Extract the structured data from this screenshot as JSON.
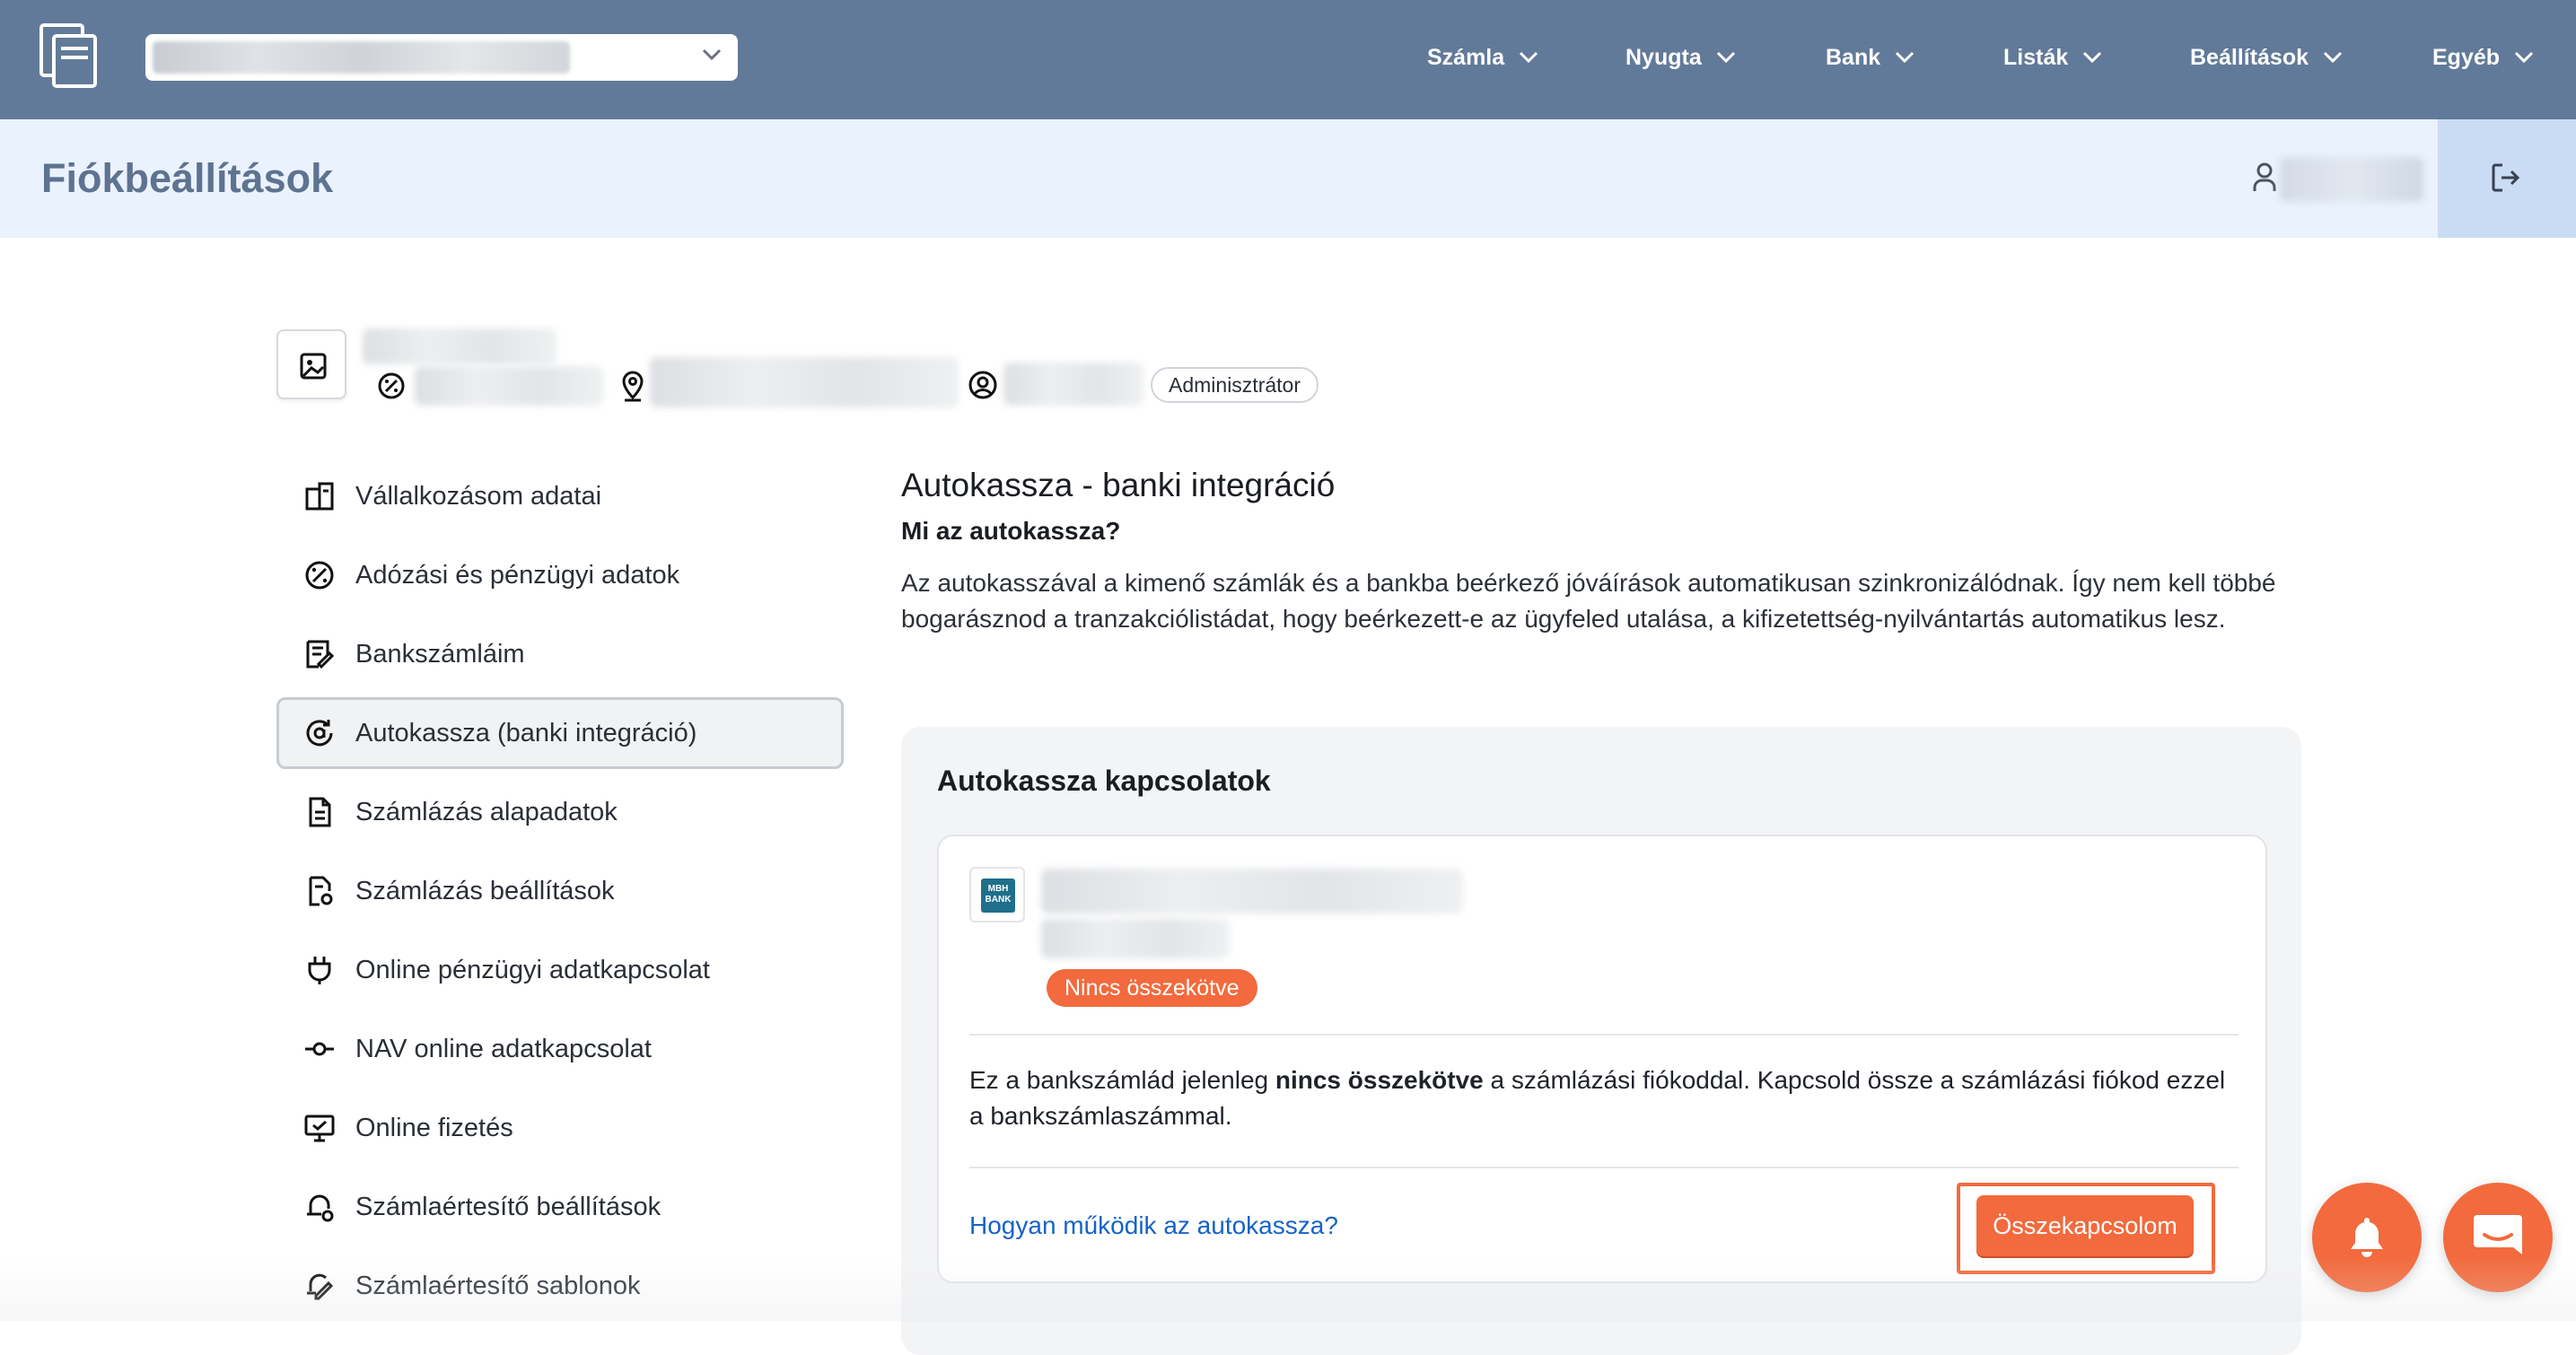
{
  "topbar": {
    "nav": [
      {
        "label": "Számla"
      },
      {
        "label": "Nyugta"
      },
      {
        "label": "Bank"
      },
      {
        "label": "Listák"
      },
      {
        "label": "Beállítások"
      },
      {
        "label": "Egyéb"
      }
    ]
  },
  "header": {
    "title": "Fiókbeállítások"
  },
  "profile": {
    "role": "Adminisztrátor"
  },
  "sidebar": {
    "items": [
      {
        "label": "Vállalkozásom adatai",
        "icon": "building-icon"
      },
      {
        "label": "Adózási és pénzügyi adatok",
        "icon": "percent-icon"
      },
      {
        "label": "Bankszámláim",
        "icon": "bank-document-icon"
      },
      {
        "label": "Autokassza (banki integráció)",
        "icon": "autokassza-icon",
        "active": true
      },
      {
        "label": "Számlázás alapadatok",
        "icon": "document-icon"
      },
      {
        "label": "Számlázás beállítások",
        "icon": "document-settings-icon"
      },
      {
        "label": "Online pénzügyi adatkapcsolat",
        "icon": "plug-icon"
      },
      {
        "label": "NAV online adatkapcsolat",
        "icon": "connection-icon"
      },
      {
        "label": "Online fizetés",
        "icon": "monitor-payment-icon"
      },
      {
        "label": "Számlaértesítő beállítások",
        "icon": "notification-settings-icon"
      },
      {
        "label": "Számlaértesítő sablonok",
        "icon": "template-edit-icon"
      }
    ]
  },
  "main": {
    "title": "Autokassza - banki integráció",
    "subtitle": "Mi az autokassza?",
    "intro": "Az autokasszával a kimenő számlák és a bankba beérkező jóváírások automatikusan szinkronizálódnak. Így nem kell többé bogarásznod a tranzakciólistádat, hogy beérkezett-e az ügyfeled utalása, a kifizetettség-nyilvántartás automatikus lesz.",
    "panel": {
      "title": "Autokassza kapcsolatok",
      "card": {
        "bank_logo_text": "MBH BANK",
        "status": "Nincs összekötve",
        "text_before": "Ez a bankszámlád jelenleg ",
        "text_bold": "nincs összekötve",
        "text_after": " a számlázási fiókoddal. Kapcsold össze a számlázási fiókod ezzel a bankszámlaszámmal.",
        "help_link": "Hogyan működik az autokassza?",
        "connect_button": "Összekapcsolom"
      }
    }
  },
  "colors": {
    "topbar": "#627a99",
    "header_band": "#eaf2fd",
    "accent": "#f26a3d",
    "link": "#1663c7"
  }
}
